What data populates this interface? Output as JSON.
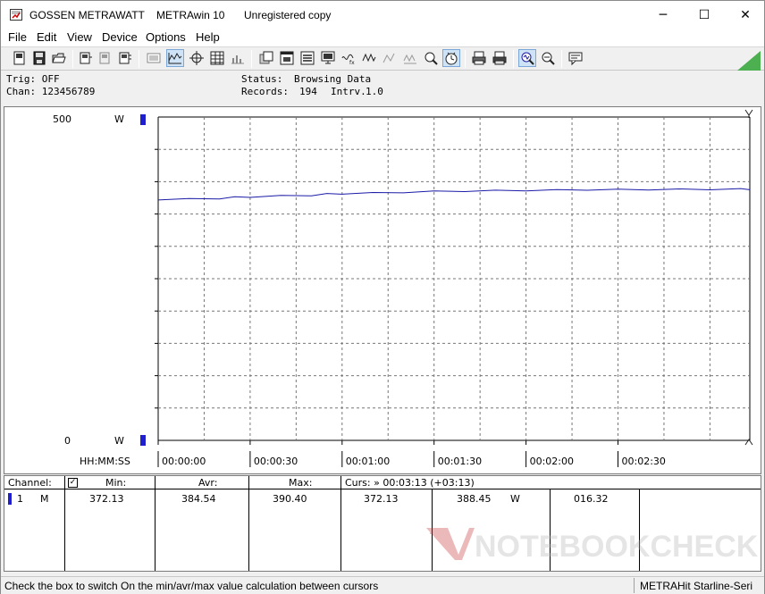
{
  "window": {
    "company": "GOSSEN METRAWATT",
    "app": "METRAwin 10",
    "license": "Unregistered copy",
    "minimize": "─",
    "maximize": "☐",
    "close": "✕"
  },
  "menu": [
    "File",
    "Edit",
    "View",
    "Device",
    "Options",
    "Help"
  ],
  "info": {
    "trig": "Trig: OFF",
    "chan": "Chan:  123456789",
    "status_label": "Status:",
    "status_value": "Browsing Data",
    "records_label": "Records:",
    "records_value": "194",
    "intrv_label": "Intrv.",
    "intrv_value": "1.0"
  },
  "chart_data": {
    "type": "line",
    "y_max_label": "500",
    "y_min_label": "0",
    "y_unit": "W",
    "ylim": [
      0,
      500
    ],
    "xlabel": "HH:MM:SS",
    "x_ticks": [
      "00:00:00",
      "00:00:30",
      "00:01:00",
      "00:01:30",
      "00:02:00",
      "00:02:30"
    ],
    "x_range_seconds": [
      0,
      193
    ],
    "grid": true,
    "series": [
      {
        "color": "#1b1ba8",
        "x": [
          0,
          10,
          20,
          25,
          30,
          40,
          50,
          55,
          60,
          70,
          80,
          90,
          100,
          110,
          120,
          130,
          140,
          150,
          160,
          170,
          180,
          190,
          193
        ],
        "values": [
          372.5,
          373,
          374,
          376,
          376.5,
          378,
          379,
          381,
          381.5,
          382.5,
          383.5,
          385,
          385.5,
          386,
          386.5,
          387,
          387.5,
          387.5,
          388,
          388,
          388.3,
          388.5,
          388.45
        ]
      }
    ]
  },
  "table": {
    "headers": {
      "channel": "Channel:",
      "min": "Min:",
      "avr": "Avr:",
      "max": "Max:",
      "curs": "Curs: » 00:03:13 (+03:13)"
    },
    "row": {
      "num": "1",
      "mode": "M",
      "min": "372.13",
      "avr": "384.54",
      "max": "390.40",
      "curs_value": "372.13",
      "curs_value2": "388.45",
      "unit": "W",
      "delta": "016.32"
    },
    "watermark": "NOTEBOOKCHECK"
  },
  "statusbar": {
    "hint": "Check the box to switch On the min/avr/max value calculation between cursors",
    "device": "METRAHit Starline-Seri"
  }
}
